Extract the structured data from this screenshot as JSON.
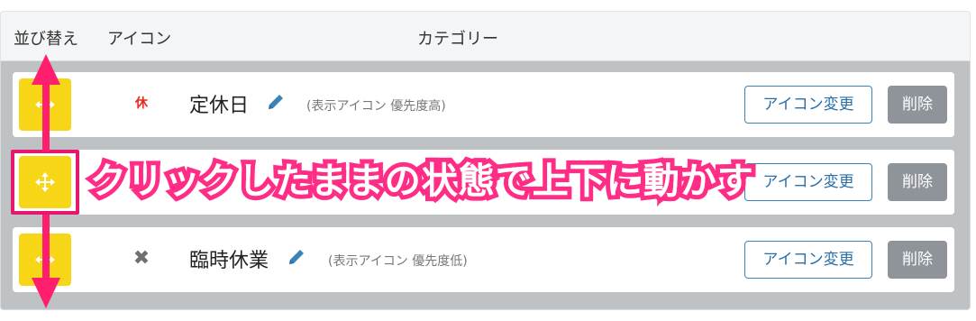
{
  "header": {
    "col_sort": "並び替え",
    "col_icon": "アイコン",
    "col_category": "カテゴリー"
  },
  "rows": [
    {
      "icon_char": "休",
      "icon_color": "#e8291c",
      "name": "定休日",
      "sub": "(表示アイコン 優先度高)",
      "change_label": "アイコン変更",
      "delete_label": "削除"
    },
    {
      "icon_char": "",
      "name": "",
      "sub": "",
      "change_label": "アイコン変更",
      "delete_label": "削除"
    },
    {
      "icon_char": "✖",
      "icon_color": "#6f6f6f",
      "name": "臨時休業",
      "sub": "(表示アイコン 優先度低)",
      "change_label": "アイコン変更",
      "delete_label": "削除"
    }
  ],
  "annotation": {
    "text": "クリックしたままの状態で上下に動かす",
    "color": "#ff2d86"
  },
  "colors": {
    "handle": "#f6d616",
    "panel": "#bfc2c5",
    "delete_button": "#8e9499",
    "change_border": "#3b83b5"
  }
}
